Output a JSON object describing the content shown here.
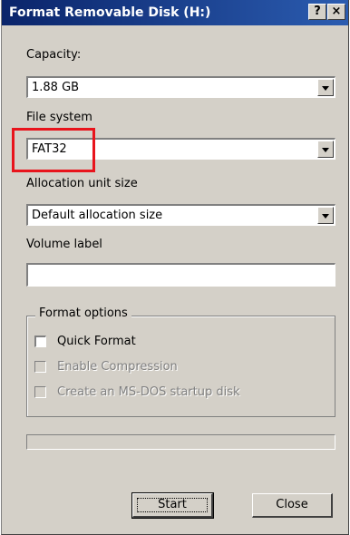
{
  "window": {
    "title": "Format Removable Disk (H:)",
    "help_button": "?",
    "close_button": "×"
  },
  "capacity": {
    "label": "Capacity:",
    "value": "1.88 GB"
  },
  "file_system": {
    "label": "File system",
    "value": "FAT32"
  },
  "allocation_unit": {
    "label": "Allocation unit size",
    "value": "Default allocation size"
  },
  "volume_label": {
    "label": "Volume label",
    "value": ""
  },
  "format_options": {
    "title": "Format options",
    "quick_format": {
      "label": "Quick Format",
      "checked": false,
      "enabled": true
    },
    "enable_compression": {
      "label": "Enable Compression",
      "checked": false,
      "enabled": false
    },
    "msdos_startup": {
      "label": "Create an MS-DOS startup disk",
      "checked": false,
      "enabled": false
    }
  },
  "progress": {
    "value": 0
  },
  "buttons": {
    "start": "Start",
    "close": "Close"
  },
  "colors": {
    "titlebar": "#0a246a",
    "dialog_bg": "#d4d0c8",
    "highlight": "#e8141c"
  }
}
